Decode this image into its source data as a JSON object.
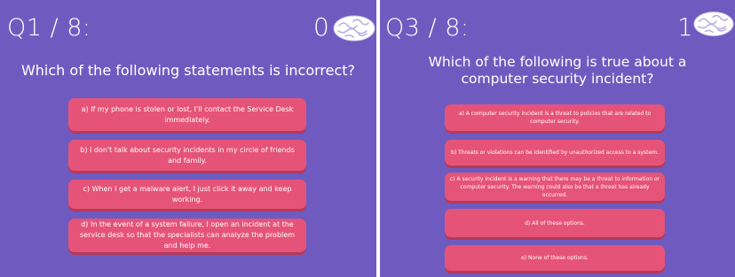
{
  "left": {
    "counter": "Q1 / 8:",
    "score": "0",
    "score_icon": "brain-icon",
    "question": "Which of the following statements is incorrect?",
    "options": [
      "a) If my phone is stolen or lost, I'll contact the Service Desk immediately.",
      "b) I don't talk about security incidents in my circle of friends and family.",
      "c) When I get a malware alert, I just click it away and keep working.",
      "d) In the event of a system failure, I open an incident at the service desk so that the specialists can analyze the problem and help me."
    ]
  },
  "right": {
    "counter": "Q3 / 8:",
    "score": "1",
    "score_icon": "brain-icon",
    "question": "Which of the following is true about a computer security incident?",
    "options": [
      "a) A computer security incident is a threat to policies that are related to computer security.",
      "b) Threats or violations can be identified by unauthorized access to a system.",
      "c) A security incident is a warning that there may be a threat to information or computer security. The warning could also be that a threat has already occurred.",
      "d) All of these options.",
      "e) None of these options."
    ]
  },
  "colors": {
    "background": "#6f5bc0",
    "option_fill": "#e55478",
    "option_shadow": "#b33a5c",
    "text": "#ffffff"
  }
}
